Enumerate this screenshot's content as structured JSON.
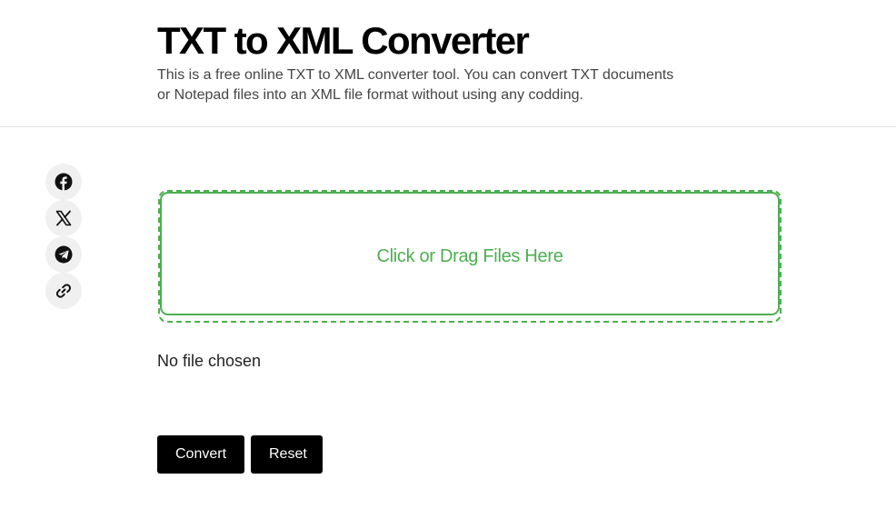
{
  "header": {
    "title": "TXT to XML Converter",
    "description": "This is a free online TXT to XML converter tool. You can convert TXT documents or Notepad files into an XML file format without using any codding."
  },
  "share": {
    "items": [
      {
        "icon": "facebook-icon"
      },
      {
        "icon": "x-twitter-icon"
      },
      {
        "icon": "telegram-icon"
      },
      {
        "icon": "link-icon"
      }
    ]
  },
  "upload": {
    "dropzone_label": "Click or Drag Files Here",
    "file_status": "No file chosen"
  },
  "actions": {
    "convert_label": "Convert",
    "reset_label": "Reset"
  },
  "colors": {
    "accent": "#4caf50",
    "button_bg": "#000000",
    "share_bg": "#f0f0f0"
  }
}
